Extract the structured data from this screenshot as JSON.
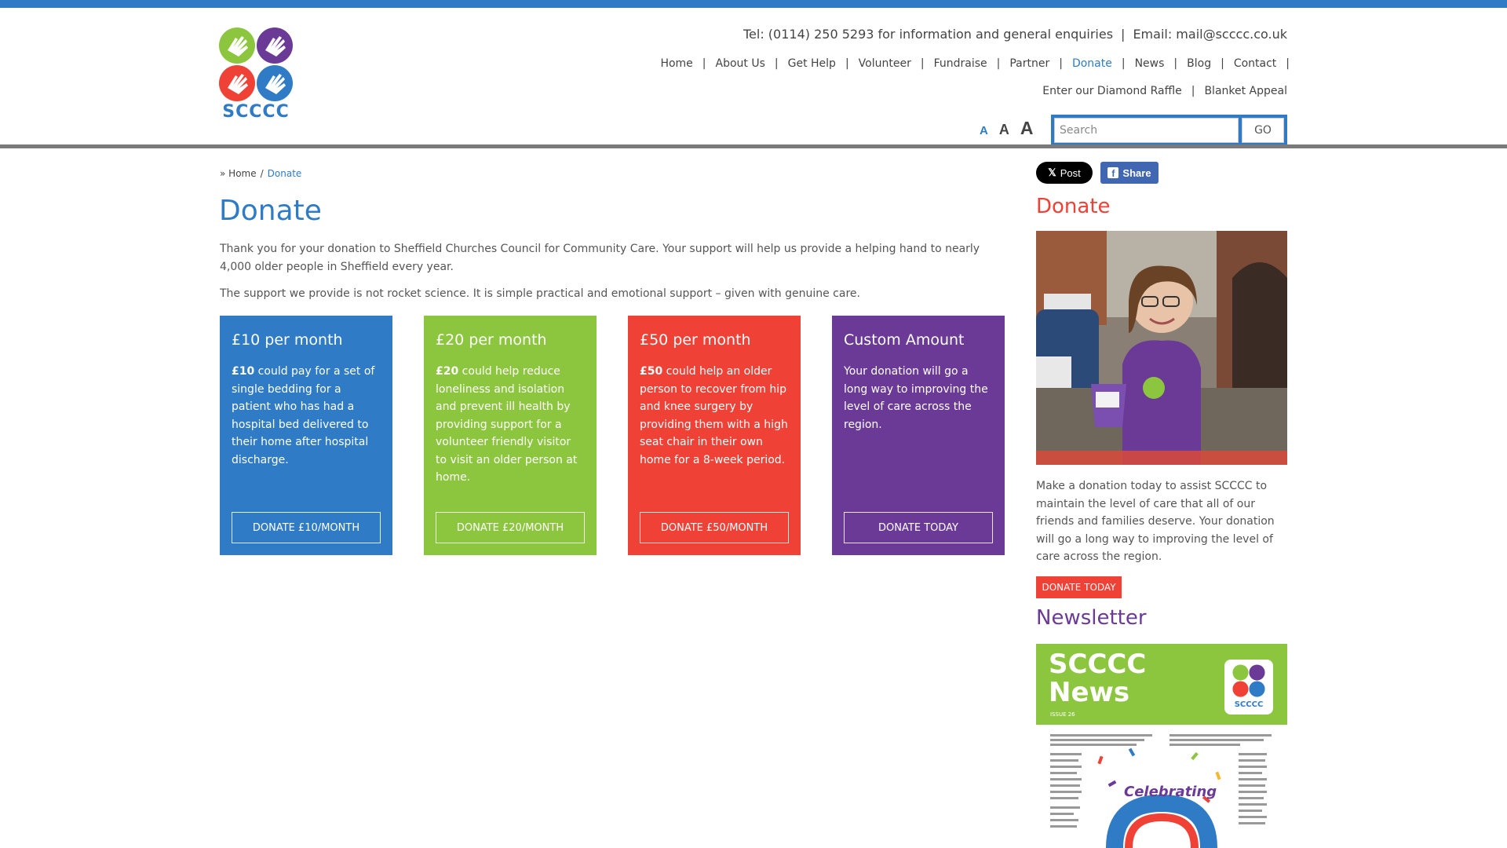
{
  "header": {
    "contact_phone": "Tel: (0114) 250 5293 for information and general enquiries",
    "contact_sep": "|",
    "contact_email": "Email: mail@scccc.co.uk",
    "logo_text": "SCCCC",
    "nav": [
      {
        "label": "Home"
      },
      {
        "label": "About Us"
      },
      {
        "label": "Get Help"
      },
      {
        "label": "Volunteer"
      },
      {
        "label": "Fundraise"
      },
      {
        "label": "Partner"
      },
      {
        "label": "Donate",
        "active": true
      },
      {
        "label": "News"
      },
      {
        "label": "Blog"
      },
      {
        "label": "Contact"
      }
    ],
    "sub_nav": [
      "Enter our Diamond Raffle",
      "Blanket Appeal"
    ],
    "font_sizes": [
      "A",
      "A",
      "A"
    ],
    "search_placeholder": "Search",
    "search_button": "GO"
  },
  "breadcrumb": {
    "prefix": "»",
    "home": "Home",
    "sep": "/",
    "current": "Donate"
  },
  "page": {
    "title": "Donate",
    "intro1": "Thank you for your donation to Sheffield Churches Council for Community Care. Your support will help us provide a helping hand to nearly 4,000 older people in Sheffield every year.",
    "intro2": "The support we provide is not rocket science. It is simple practical and emotional support – given with genuine care."
  },
  "boxes": [
    {
      "title": "£10 per month",
      "amount": "£10",
      "text": " could pay for a set of single bedding for a patient who has had a hospital bed delivered to their home after hospital discharge.",
      "button": "DONATE £10/MONTH"
    },
    {
      "title": "£20 per month",
      "amount": "£20",
      "text": " could help reduce loneliness and isolation and prevent ill health by providing support for a volunteer friendly visitor to visit an older person at home.",
      "button": "DONATE £20/MONTH"
    },
    {
      "title": "£50 per month",
      "amount": "£50",
      "text": " could help an older person to recover from hip and knee surgery by providing them with a high seat chair in their own home for a 8-week period.",
      "button": "DONATE £50/MONTH"
    },
    {
      "title": "Custom Amount",
      "amount": "",
      "text": "Your donation will go a long way to improving the level of care across the region.",
      "button": "DONATE TODAY"
    }
  ],
  "sidebar": {
    "x_post": "Post",
    "fb_share": "Share",
    "donate_heading": "Donate",
    "donate_text": "Make a donation today to assist SCCCC to maintain the level of care that all of our friends and families deserve. Your donation will go a long way to improving the level of care across the region.",
    "donate_button": "DONATE TODAY",
    "newsletter_heading": "Newsletter",
    "newsletter_title_1": "SCCCC",
    "newsletter_title_2": "News",
    "newsletter_issue": "ISSUE 26",
    "newsletter_logo_text": "SCCCC",
    "newsletter_celebrating": "Celebrating"
  },
  "colors": {
    "blue": "#2f7bc5",
    "green": "#8cc63f",
    "red": "#ef4136",
    "purple": "#6b3a96"
  }
}
